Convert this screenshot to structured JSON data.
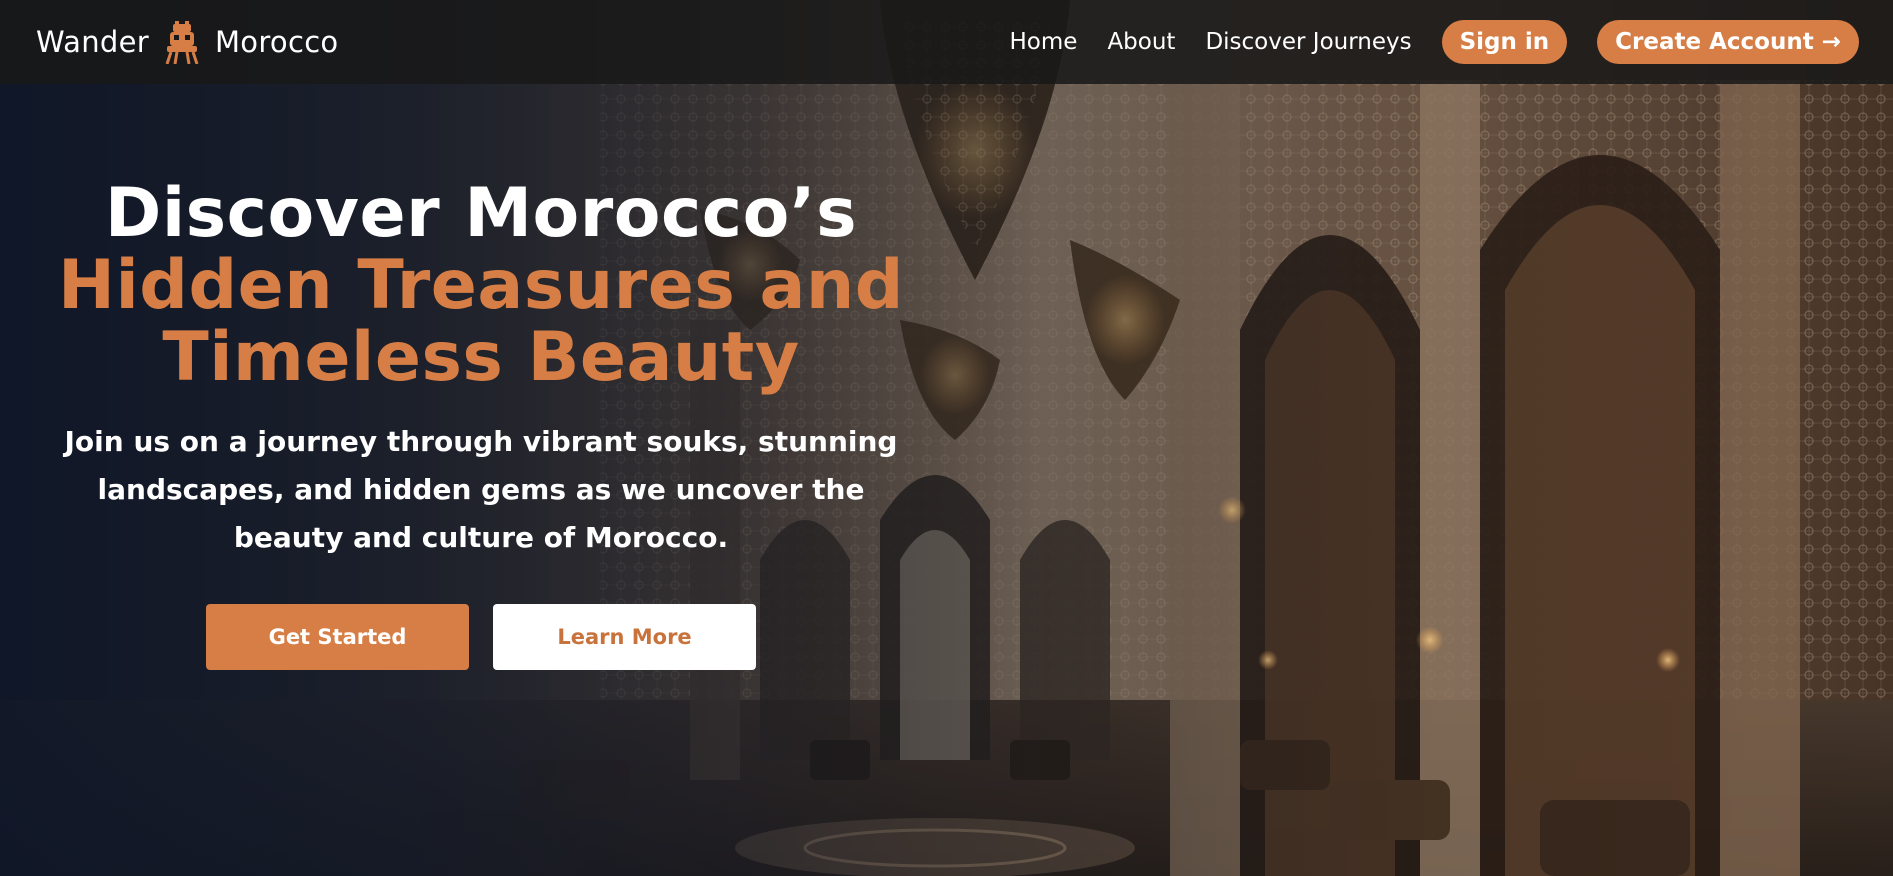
{
  "brand": {
    "name_left": "Wander",
    "name_right": "Morocco",
    "logo_icon": "camel-rider-icon"
  },
  "nav": {
    "links": [
      "Home",
      "About",
      "Discover Journeys"
    ],
    "sign_in": "Sign in",
    "create_account": "Create Account →"
  },
  "hero": {
    "title_line1": "Discover Morocco’s",
    "title_line2": "Hidden Treasures and",
    "title_line3": "Timeless Beauty",
    "subtitle": "Join us on a journey through vibrant souks, stunning landscapes, and hidden gems as we uncover the beauty and culture of Morocco.",
    "primary_button": "Get Started",
    "secondary_button": "Learn More"
  },
  "colors": {
    "accent": "#d67e45",
    "header_bg": "#181818",
    "text": "#ffffff"
  }
}
